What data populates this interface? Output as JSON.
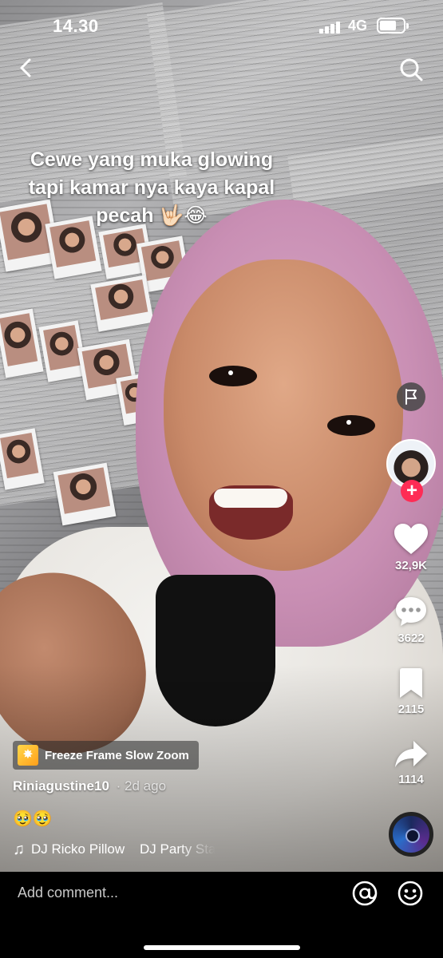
{
  "status_bar": {
    "time": "14.30",
    "network": "4G"
  },
  "nav": {
    "back_icon": "chevron-left-icon",
    "search_icon": "search-icon"
  },
  "video": {
    "caption": "Cewe yang muka glowing tapi kamar nya kaya kapal pecah 🤟🏻😂"
  },
  "right_rail": {
    "report_icon": "flag-icon",
    "follow_label": "+",
    "like_count": "32,9K",
    "comment_count": "3622",
    "bookmark_count": "2115",
    "share_count": "1114"
  },
  "info": {
    "effect_label": "Freeze Frame Slow Zoom",
    "author": "Riniagustine10",
    "time_ago": "· 2d ago",
    "description": "🥹🥹",
    "music_text": "DJ Ricko Pillow    DJ Party Sta"
  },
  "comment_bar": {
    "placeholder": "Add comment..."
  },
  "colors": {
    "follow_accent": "#fe2c55",
    "comment_bar_bg": "#000000"
  }
}
